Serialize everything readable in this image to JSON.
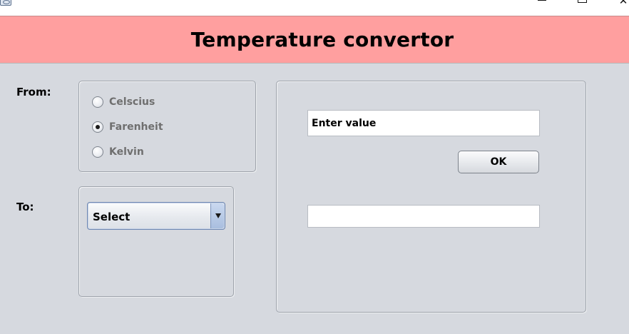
{
  "window": {
    "icon": "app-icon",
    "controls": [
      "minimize-icon",
      "maximize-icon",
      "close-icon"
    ]
  },
  "header": {
    "title": "Temperature convertor",
    "background": "#ff9f9f"
  },
  "from": {
    "label": "From:",
    "options": [
      {
        "label": "Celscius",
        "checked": false
      },
      {
        "label": "Farenheit",
        "checked": true
      },
      {
        "label": "Kelvin",
        "checked": false
      }
    ]
  },
  "to": {
    "label": "To:",
    "select_value": "Select"
  },
  "input": {
    "value": "Enter value"
  },
  "ok_button": {
    "label": "OK"
  },
  "output": {
    "value": ""
  },
  "colors": {
    "content_background": "#d6d9df"
  }
}
